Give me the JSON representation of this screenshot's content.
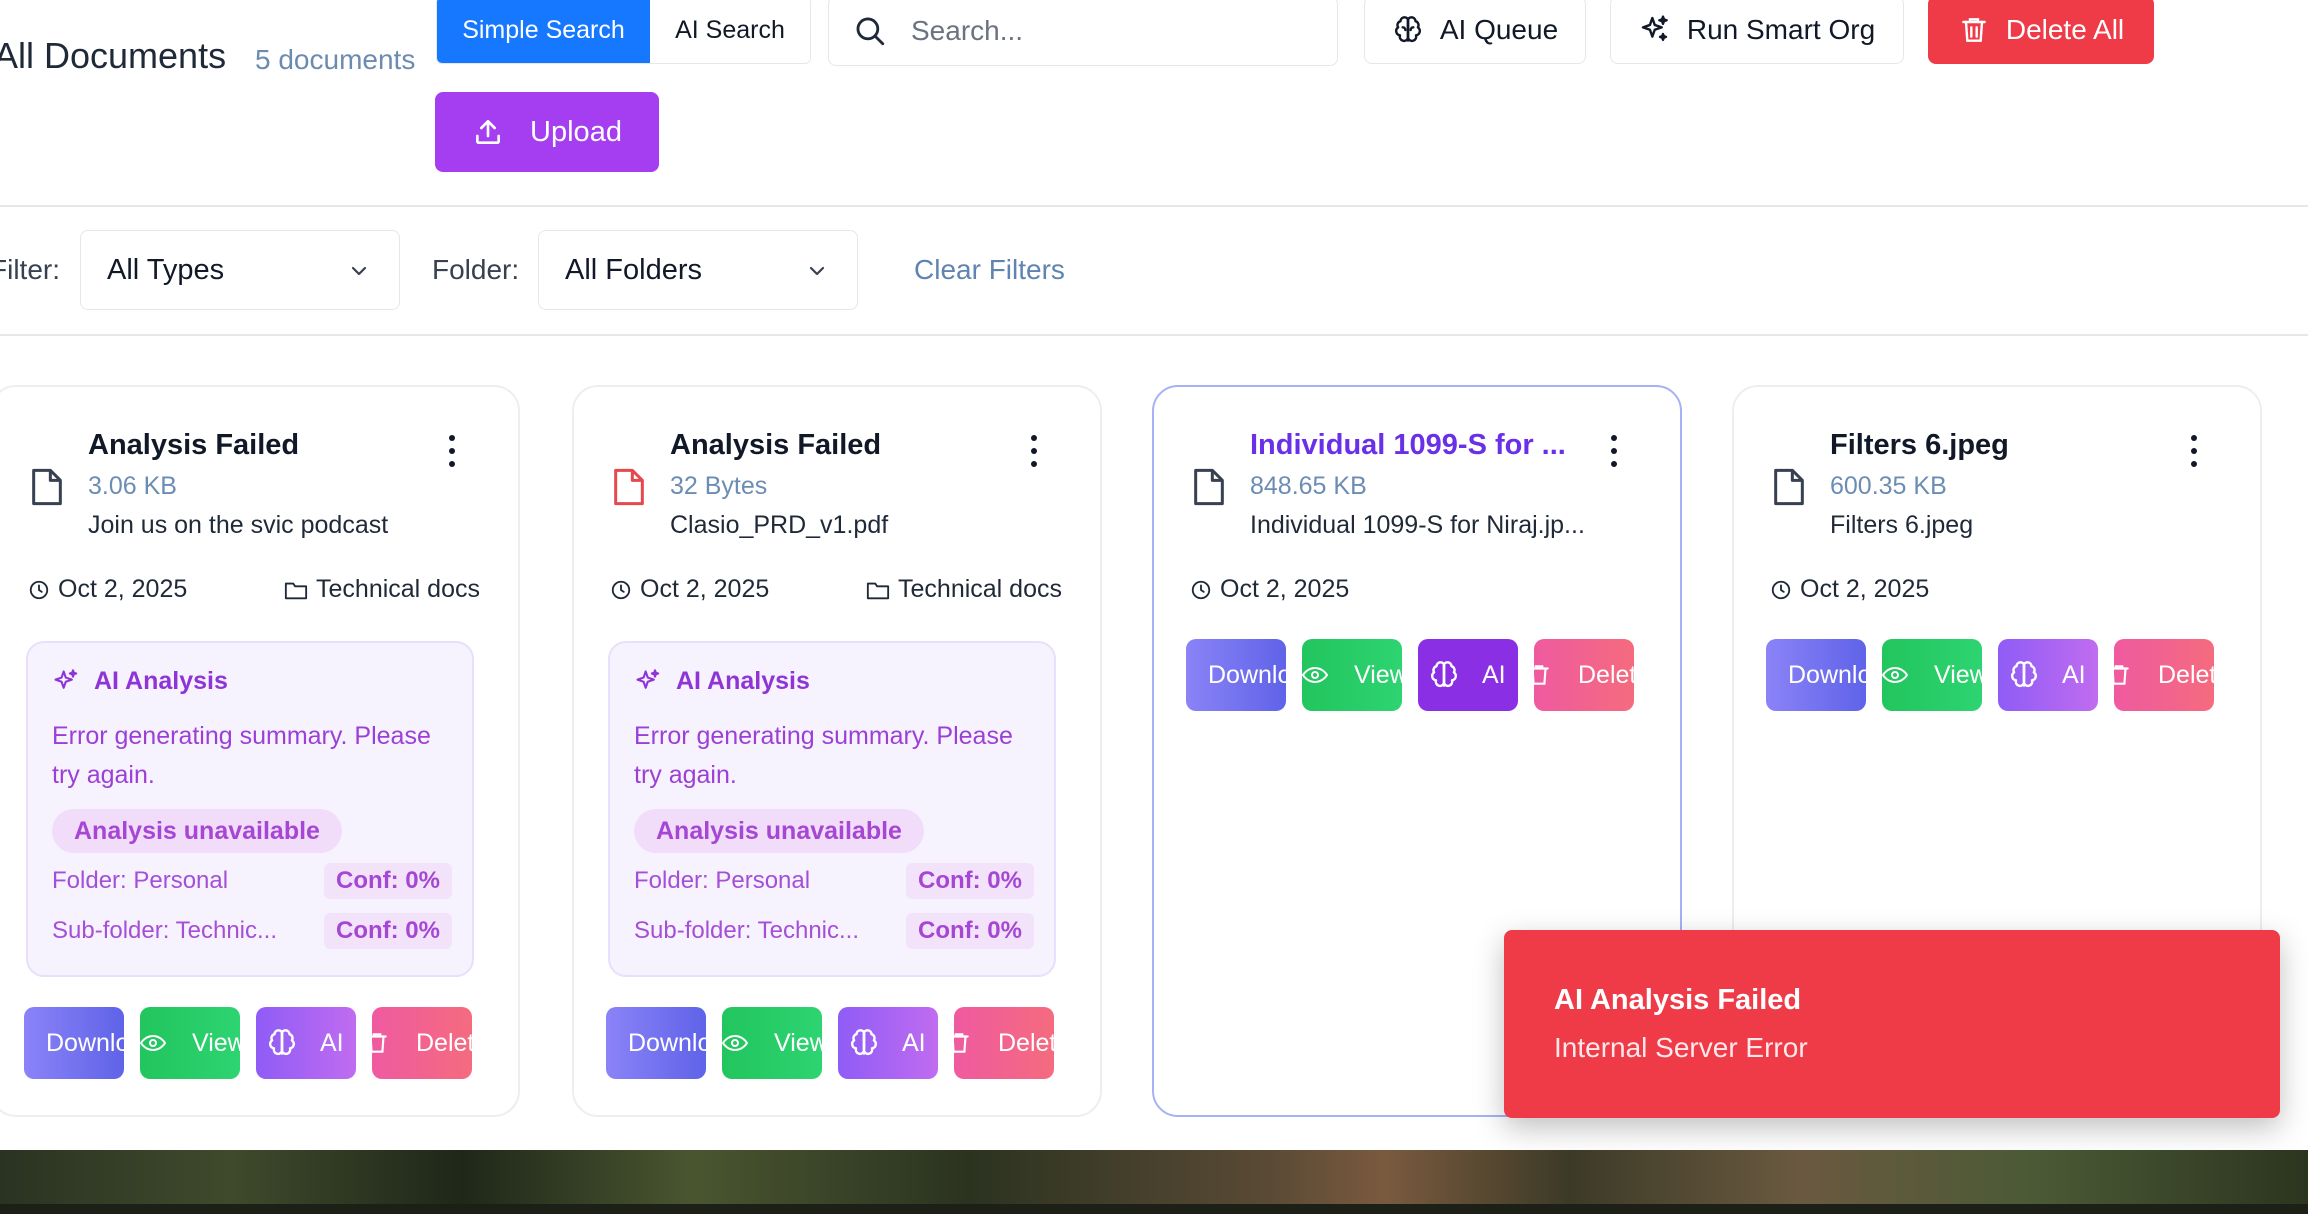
{
  "header": {
    "title": "All Documents",
    "doc_count": "5 documents",
    "search_modes": [
      "Simple Search",
      "AI Search"
    ],
    "search_placeholder": "Search...",
    "ai_queue_label": "AI Queue",
    "smart_org_label": "Run Smart Org",
    "delete_all_label": "Delete All",
    "upload_label": "Upload"
  },
  "filters": {
    "filter_label": "Filter:",
    "type_value": "All Types",
    "folder_label": "Folder:",
    "folder_value": "All Folders",
    "clear_label": "Clear Filters"
  },
  "cards": [
    {
      "title": "Analysis Failed",
      "size": "3.06 KB",
      "desc": "Join us on the svic podcast",
      "date": "Oct 2, 2025",
      "folder": "Technical docs",
      "ai": {
        "heading": "AI Analysis",
        "error": "Error generating summary. Please try again.",
        "badge": "Analysis unavailable",
        "folder_line": "Folder: Personal",
        "folder_conf": "Conf: 0%",
        "subfolder_line": "Sub-folder: Technic...",
        "subfolder_conf": "Conf: 0%"
      },
      "actions": {
        "download": "Download",
        "view": "View",
        "ai": "AI",
        "delete": "Delete"
      }
    },
    {
      "title": "Analysis Failed",
      "size": "32 Bytes",
      "desc": "Clasio_PRD_v1.pdf",
      "date": "Oct 2, 2025",
      "folder": "Technical docs",
      "ai": {
        "heading": "AI Analysis",
        "error": "Error generating summary. Please try again.",
        "badge": "Analysis unavailable",
        "folder_line": "Folder: Personal",
        "folder_conf": "Conf: 0%",
        "subfolder_line": "Sub-folder: Technic...",
        "subfolder_conf": "Conf: 0%"
      },
      "actions": {
        "download": "Download",
        "view": "View",
        "ai": "AI",
        "delete": "Delete"
      }
    },
    {
      "title": "Individual 1099-S for ...",
      "size": "848.65 KB",
      "desc": "Individual 1099-S for Niraj.jp...",
      "date": "Oct 2, 2025",
      "actions": {
        "download": "Download",
        "view": "View",
        "ai": "AI",
        "delete": "Delete"
      }
    },
    {
      "title": "Filters 6.jpeg",
      "size": "600.35 KB",
      "desc": "Filters 6.jpeg",
      "date": "Oct 2, 2025",
      "actions": {
        "download": "Download",
        "view": "View",
        "ai": "AI",
        "delete": "Delete"
      }
    }
  ],
  "toast": {
    "title": "AI Analysis Failed",
    "message": "Internal Server Error"
  },
  "colors": {
    "primary_blue": "#1677ff",
    "upload_purple": "#a53df0",
    "danger_red": "#ef3b47",
    "pdf_icon_red": "#e5484d"
  }
}
